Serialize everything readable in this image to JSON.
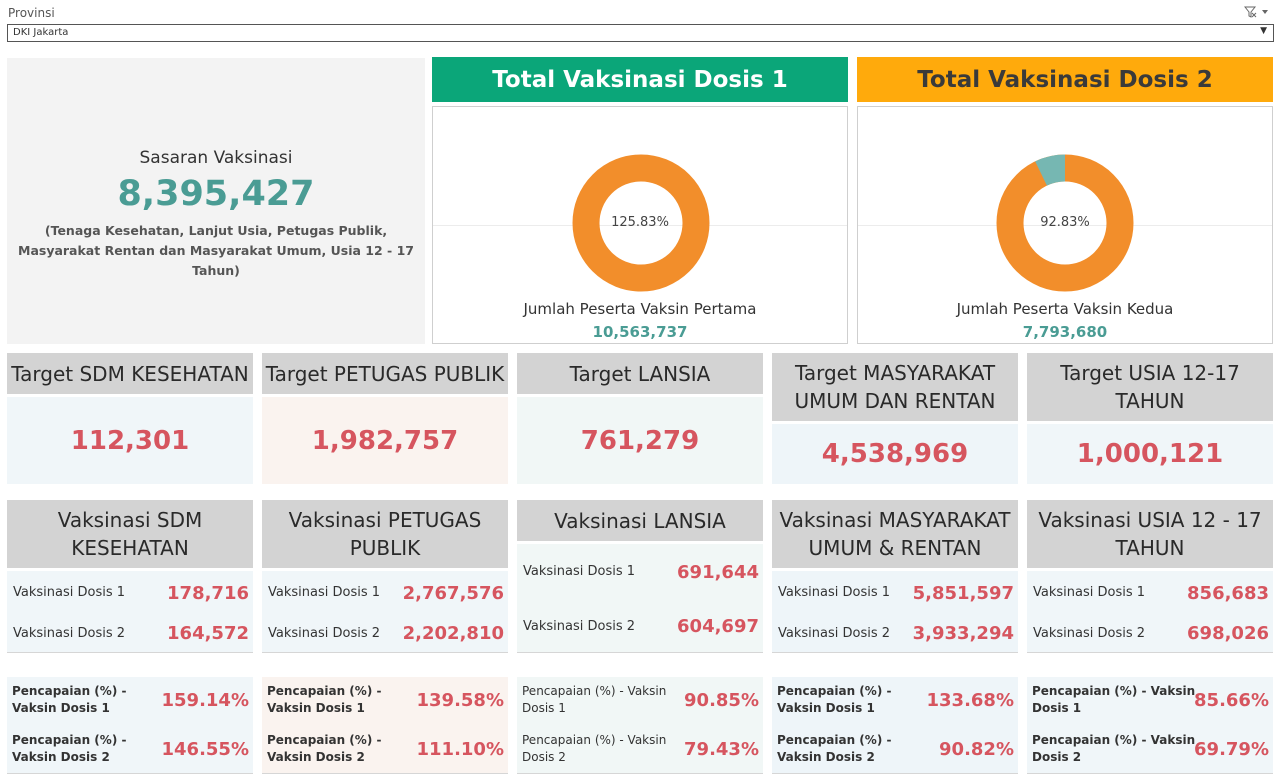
{
  "filter": {
    "label": "Provinsi",
    "selected": "DKI Jakarta",
    "icon": "clear-filter-icon"
  },
  "sasaran": {
    "title": "Sasaran Vaksinasi",
    "value": "8,395,427",
    "desc_line1": "(Tenaga Kesehatan, Lanjut Usia, Petugas Publik,",
    "desc_line2": "Masyarakat Rentan dan Masyarakat Umum, Usia 12 - 17 Tahun)"
  },
  "dose1": {
    "title": "Total Vaksinasi Dosis 1",
    "percent_label": "125.83%",
    "percent": 125.83,
    "label": "Jumlah Peserta Vaksin Pertama",
    "count": "10,563,737",
    "header_color": "#0ba679",
    "ring_color": "#f28e2b"
  },
  "dose2": {
    "title": "Total Vaksinasi Dosis 2",
    "percent_label": "92.83%",
    "percent": 92.83,
    "label": "Jumlah Peserta Vaksin Kedua",
    "count": "7,793,680",
    "header_color": "#ffaa0c",
    "ring_color": "#f28e2b",
    "remainder_color": "#76b7b2"
  },
  "targets": [
    {
      "title": "Target SDM KESEHATAN",
      "value": "112,301",
      "bg": "#f0f6f9"
    },
    {
      "title": "Target PETUGAS PUBLIK",
      "value": "1,982,757",
      "bg": "#faf3ef"
    },
    {
      "title": "Target LANSIA",
      "value": "761,279",
      "bg": "#f1f7f6"
    },
    {
      "title": "Target MASYARAKAT UMUM DAN RENTAN",
      "value": "4,538,969",
      "bg": "#eef5f9"
    },
    {
      "title": "Target USIA 12-17 TAHUN",
      "value": "1,000,121",
      "bg": "#f0f6f9"
    }
  ],
  "vaksinasi": [
    {
      "title": "Vaksinasi SDM KESEHATAN",
      "d1_label": "Vaksinasi Dosis 1",
      "d1": "178,716",
      "d2_label": "Vaksinasi Dosis 2",
      "d2": "164,572",
      "bg": "#f0f6f9"
    },
    {
      "title": "Vaksinasi PETUGAS PUBLIK",
      "d1_label": "Vaksinasi Dosis 1",
      "d1": "2,767,576",
      "d2_label": "Vaksinasi Dosis 2",
      "d2": "2,202,810",
      "bg": "#f0f6f9"
    },
    {
      "title": "Vaksinasi LANSIA",
      "d1_label": "Vaksinasi Dosis 1",
      "d1": "691,644",
      "d2_label": "Vaksinasi Dosis 2",
      "d2": "604,697",
      "bg": "#f1f7f6"
    },
    {
      "title": "Vaksinasi MASYARAKAT UMUM & RENTAN",
      "d1_label": "Vaksinasi Dosis 1",
      "d1": "5,851,597",
      "d2_label": "Vaksinasi Dosis 2",
      "d2": "3,933,294",
      "bg": "#eef5f9"
    },
    {
      "title": "Vaksinasi USIA 12 - 17 TAHUN",
      "d1_label": "Vaksinasi Dosis 1",
      "d1": "856,683",
      "d2_label": "Vaksinasi Dosis 2",
      "d2": "698,026",
      "bg": "#f0f6f9"
    }
  ],
  "pencapaian": [
    {
      "p1_line1": "Pencapaian (%) -",
      "p1_line2": "Vaksin Dosis 1",
      "p1": "159.14%",
      "p2_line1": "Pencapaian (%) -",
      "p2_line2": "Vaksin Dosis 2",
      "p2": "146.55%",
      "bg": "#f0f6f9",
      "bold": true
    },
    {
      "p1_line1": "Pencapaian (%) -",
      "p1_line2": "Vaksin Dosis 1",
      "p1": "139.58%",
      "p2_line1": "Pencapaian (%) -",
      "p2_line2": "Vaksin Dosis 2",
      "p2": "111.10%",
      "bg": "#faf3ef",
      "bold": true
    },
    {
      "p1_line1": "Pencapaian (%) - Vaksin",
      "p1_line2": "Dosis 1",
      "p1": "90.85%",
      "p2_line1": "Pencapaian (%) - Vaksin",
      "p2_line2": "Dosis 2",
      "p2": "79.43%",
      "bg": "#f1f7f6",
      "bold": false
    },
    {
      "p1_line1": "Pencapaian (%) -",
      "p1_line2": "Vaksin Dosis 1",
      "p1": "133.68%",
      "p2_line1": "Pencapaian (%) -",
      "p2_line2": "Vaksin Dosis 2",
      "p2": "90.82%",
      "bg": "#eef5f9",
      "bold": true
    },
    {
      "p1_line1": "Pencapaian (%) - Vaksin",
      "p1_line2": "Dosis 1",
      "p1": "85.66%",
      "p2_line1": "Pencapaian (%) - Vaksin",
      "p2_line2": "Dosis 2",
      "p2": "69.79%",
      "bg": "#f0f6f9",
      "bold": true
    }
  ]
}
